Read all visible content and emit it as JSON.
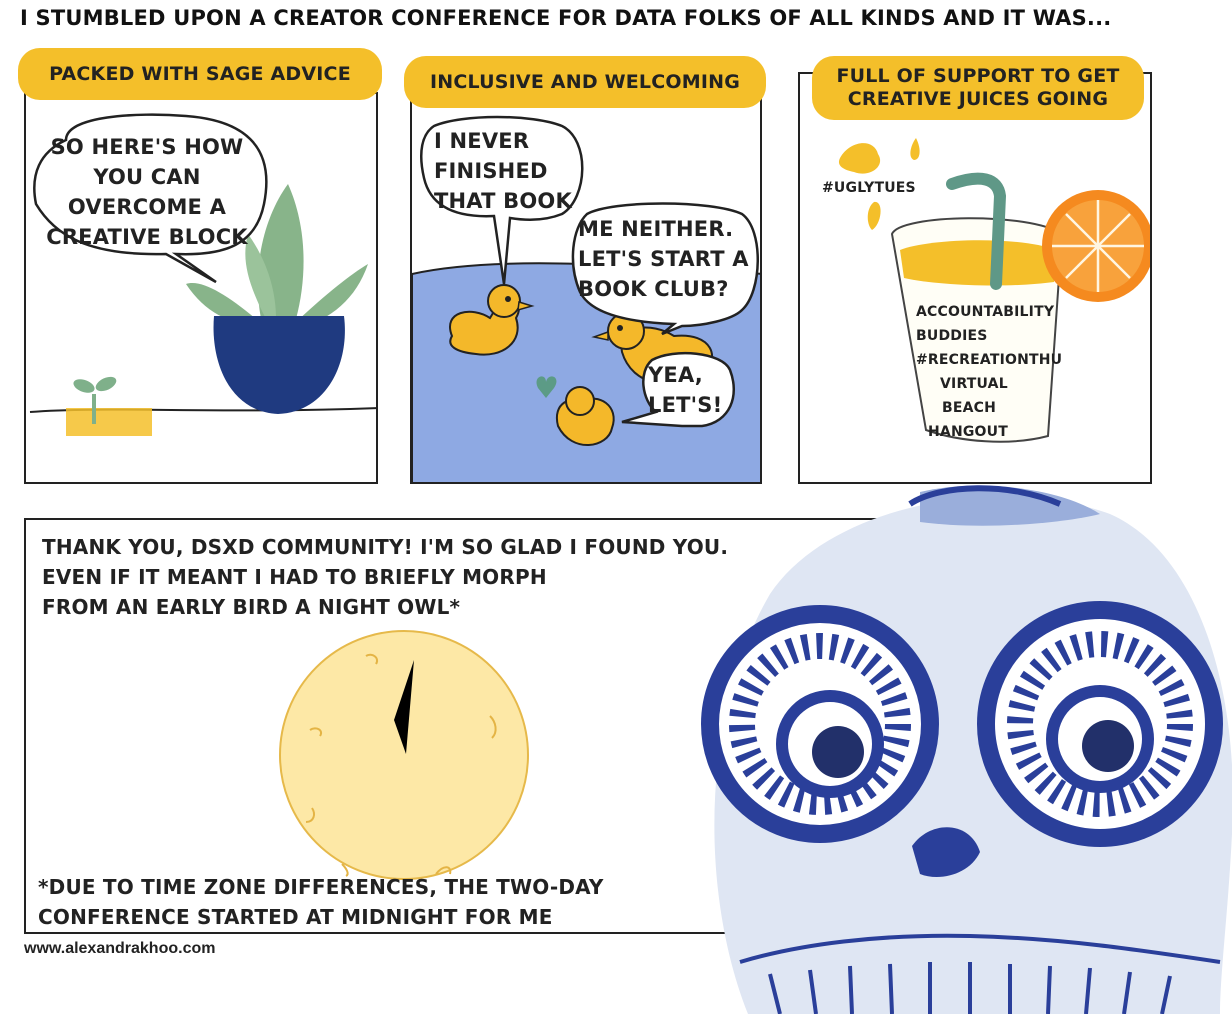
{
  "title": "I STUMBLED UPON A CREATOR CONFERENCE FOR DATA FOLKS OF ALL KINDS AND IT WAS...",
  "panels": [
    {
      "banner": "PACKED WITH SAGE ADVICE",
      "bubble_lines": [
        "SO HERE'S HOW",
        "YOU CAN",
        "OVERCOME A",
        "CREATIVE BLOCK"
      ]
    },
    {
      "banner": "INCLUSIVE AND WELCOMING",
      "bubble1_lines": [
        "I NEVER",
        "FINISHED",
        "THAT BOOK"
      ],
      "bubble2_lines": [
        "ME NEITHER.",
        "LET'S START A",
        "BOOK CLUB?"
      ],
      "bubble3_lines": [
        "YEA,",
        "LET'S!"
      ]
    },
    {
      "banner_lines": [
        "FULL OF SUPPORT TO GET",
        "CREATIVE JUICES GOING"
      ],
      "hashtag": "#UGLYTUES",
      "cup_lines": [
        "ACCOUNTABILITY",
        "BUDDIES",
        "#RECREATIONTHU",
        "VIRTUAL",
        "BEACH",
        "HANGOUT"
      ]
    }
  ],
  "bottom": {
    "lines": [
      "THANK YOU, DSxD COMMUNITY! I'M SO GLAD I FOUND YOU.",
      "EVEN IF IT MEANT I HAD TO BRIEFLY MORPH",
      "FROM AN EARLY BIRD A NIGHT OWL*"
    ],
    "footnote_lines": [
      "*DUE TO TIME ZONE DIFFERENCES, THE TWO-DAY",
      "CONFERENCE STARTED AT MIDNIGHT FOR ME"
    ]
  },
  "url": "www.alexandrakhoo.com",
  "colors": {
    "yellow": "#f4bf2a",
    "navy": "#1f3a80",
    "pond": "#8ea9e3",
    "duck": "#f4b82a",
    "leaf": "#88b48a",
    "clock": "#fde8a6",
    "owl_porcelain": "#dfe6f3",
    "owl_blue": "#2a3f9a"
  }
}
